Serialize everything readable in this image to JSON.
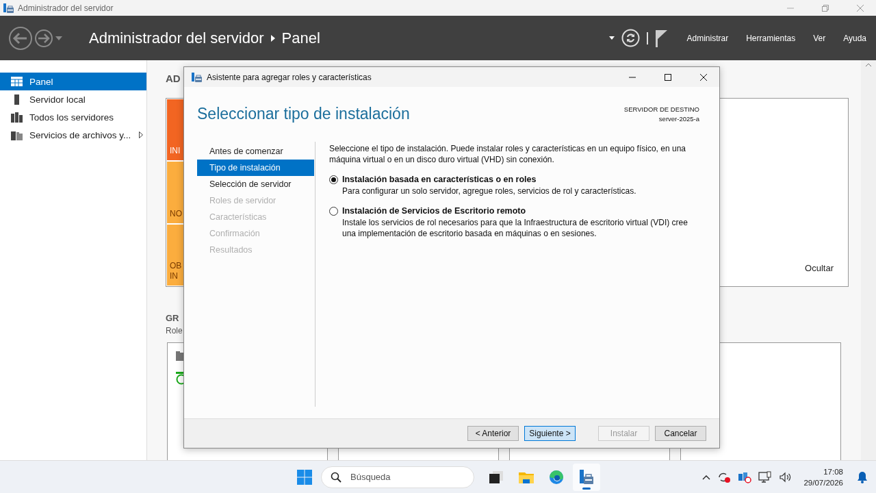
{
  "window": {
    "title": "Administrador del servidor"
  },
  "header": {
    "breadcrumb": [
      "Administrador del servidor",
      "Panel"
    ],
    "menu": [
      "Administrar",
      "Herramientas",
      "Ver",
      "Ayuda"
    ]
  },
  "sidebar": {
    "items": [
      {
        "label": "Panel",
        "kind": "dashboard",
        "selected": true,
        "expandable": false
      },
      {
        "label": "Servidor local",
        "kind": "server",
        "selected": false,
        "expandable": false
      },
      {
        "label": "Todos los servidores",
        "kind": "servers",
        "selected": false,
        "expandable": false
      },
      {
        "label": "Servicios de archivos y...",
        "kind": "files",
        "selected": false,
        "expandable": true
      }
    ]
  },
  "dashboard": {
    "heading": "AD",
    "tiles": [
      {
        "lines": [
          "INI"
        ],
        "color": "#f26522"
      },
      {
        "lines": [
          "NO"
        ],
        "color": "#fbad3e"
      },
      {
        "lines": [
          "OB",
          "IN"
        ],
        "color": "#fbad3e"
      }
    ],
    "hide_link": "Ocultar",
    "group_heading": "GR",
    "group_subtitle": "Role"
  },
  "dialog": {
    "title": "Asistente para agregar roles y características",
    "heading": "Seleccionar tipo de instalación",
    "destination_label": "SERVIDOR DE DESTINO",
    "destination_server": "server-2025-a",
    "steps": [
      {
        "label": "Antes de comenzar",
        "selected": false,
        "disabled": false
      },
      {
        "label": "Tipo de instalación",
        "selected": true,
        "disabled": false
      },
      {
        "label": "Selección de servidor",
        "selected": false,
        "disabled": false
      },
      {
        "label": "Roles de servidor",
        "selected": false,
        "disabled": true
      },
      {
        "label": "Características",
        "selected": false,
        "disabled": true
      },
      {
        "label": "Confirmación",
        "selected": false,
        "disabled": true
      },
      {
        "label": "Resultados",
        "selected": false,
        "disabled": true
      }
    ],
    "intro": "Seleccione el tipo de instalación. Puede instalar roles y características en un equipo físico, en una máquina virtual o en un disco duro virtual (VHD) sin conexión.",
    "options": [
      {
        "label": "Instalación basada en características o en roles",
        "description": "Para configurar un solo servidor, agregue roles, servicios de rol y características.",
        "selected": true
      },
      {
        "label": "Instalación de Servicios de Escritorio remoto",
        "description": "Instale los servicios de rol necesarios para que la Infraestructura de escritorio virtual (VDI) cree una implementación de escritorio basada en máquinas o en sesiones.",
        "selected": false
      }
    ],
    "buttons": [
      {
        "label": "< Anterior",
        "default": false,
        "disabled": false
      },
      {
        "label": "Siguiente >",
        "default": true,
        "disabled": false
      },
      {
        "label": "Instalar",
        "default": false,
        "disabled": true
      },
      {
        "label": "Cancelar",
        "default": false,
        "disabled": false
      }
    ]
  },
  "taskbar": {
    "search_placeholder": "Búsqueda",
    "apps": [
      {
        "kind": "taskview",
        "active": false
      },
      {
        "kind": "explorer",
        "active": false
      },
      {
        "kind": "edge",
        "active": false
      },
      {
        "kind": "servermanager",
        "active": true
      }
    ],
    "time": "17:08",
    "date": "29/07/2026"
  }
}
